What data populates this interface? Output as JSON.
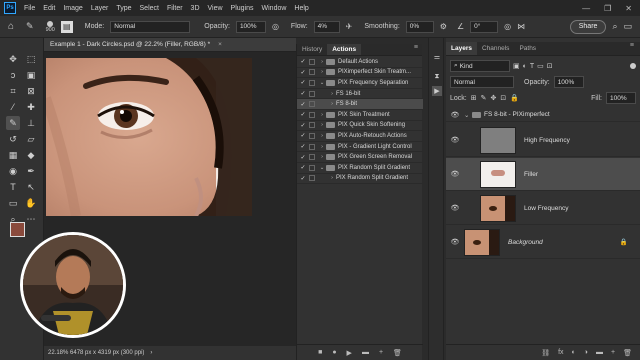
{
  "menubar": {
    "logo": "Ps",
    "items": [
      "File",
      "Edit",
      "Image",
      "Layer",
      "Type",
      "Select",
      "Filter",
      "3D",
      "View",
      "Plugins",
      "Window",
      "Help"
    ],
    "win_minimize": "—",
    "win_maximize": "❐",
    "win_close": "✕"
  },
  "options": {
    "brush_size": "900",
    "mode_label": "Mode:",
    "mode_value": "Normal",
    "opacity_label": "Opacity:",
    "opacity_value": "100%",
    "flow_label": "Flow:",
    "flow_value": "4%",
    "smoothing_label": "Smoothing:",
    "smoothing_value": "0%",
    "angle_value": "0°",
    "share_label": "Share"
  },
  "document": {
    "tab_title": "Example 1 - Dark Circles.psd @ 22.2% (Filler, RGB/8) *",
    "tab_close": "×",
    "status": "22.18%   6478 px x 4319 px (300 ppi)"
  },
  "actions_panel": {
    "tabs": [
      "History",
      "Actions"
    ],
    "active_tab": "Actions",
    "rows": [
      {
        "label": "Default Actions",
        "check": "✓",
        "arrow": "›",
        "folder": true,
        "indent": 0
      },
      {
        "label": "PIXimperfect Skin Treatm...",
        "check": "✓",
        "arrow": "›",
        "folder": true,
        "indent": 0
      },
      {
        "label": "PIX Frequency Separation",
        "check": "✓",
        "arrow": "⌄",
        "folder": true,
        "indent": 0
      },
      {
        "label": "FS 16-bit",
        "check": "✓",
        "arrow": "›",
        "folder": false,
        "indent": 1
      },
      {
        "label": "FS 8-bit",
        "check": "✓",
        "arrow": "›",
        "folder": false,
        "indent": 1,
        "selected": true
      },
      {
        "label": "PIX Skin Treatment",
        "check": "✓",
        "arrow": "›",
        "folder": true,
        "indent": 0
      },
      {
        "label": "PIX Quick Skin Softening",
        "check": "✓",
        "arrow": "›",
        "folder": true,
        "indent": 0
      },
      {
        "label": "PIX Auto-Retouch Actions",
        "check": "✓",
        "arrow": "›",
        "folder": true,
        "indent": 0
      },
      {
        "label": "PIX - Gradient Light Control",
        "check": "✓",
        "arrow": "›",
        "folder": true,
        "indent": 0
      },
      {
        "label": "PIX Green Screen Removal",
        "check": "✓",
        "arrow": "›",
        "folder": true,
        "indent": 0
      },
      {
        "label": "PIX Random Split Gradient",
        "check": "✓",
        "arrow": "⌄",
        "folder": true,
        "indent": 0
      },
      {
        "label": "PIX Random Split Gradient",
        "check": "✓",
        "arrow": "›",
        "folder": false,
        "indent": 1
      }
    ],
    "footer_icons": [
      "■",
      "●",
      "▶",
      "▬",
      "+",
      "🗑"
    ]
  },
  "layers_panel": {
    "tabs": [
      "Layers",
      "Channels",
      "Paths"
    ],
    "active_tab": "Layers",
    "kind_label": "Kind",
    "blend_mode": "Normal",
    "opacity_label": "Opacity:",
    "opacity_value": "100%",
    "lock_label": "Lock:",
    "fill_label": "Fill:",
    "fill_value": "100%",
    "group_name": "FS 8-bit - PIXimperfect",
    "layers": [
      {
        "name": "High Frequency",
        "thumb": "gray",
        "italic": false
      },
      {
        "name": "Filler",
        "thumb": "filler",
        "italic": false,
        "selected": true
      },
      {
        "name": "Low Frequency",
        "thumb": "face",
        "italic": false
      },
      {
        "name": "Background",
        "thumb": "face",
        "italic": true,
        "locked": true
      }
    ],
    "footer_icons": [
      "⛓",
      "fx",
      "◐",
      "◑",
      "▬",
      "+",
      "🗑"
    ]
  }
}
